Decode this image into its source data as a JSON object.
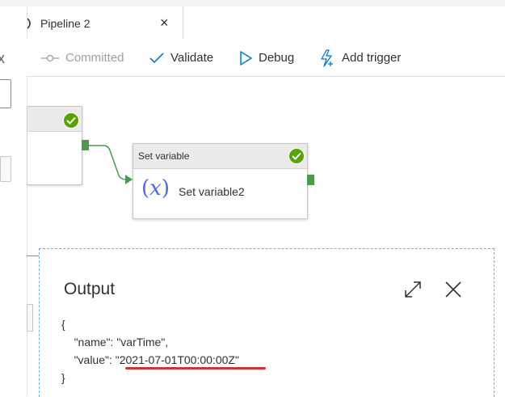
{
  "tab": {
    "title": "Pipeline 2",
    "close_label": "×",
    "icon": "pipeline-icon"
  },
  "left_panel": {
    "close_label": "x"
  },
  "toolbar": {
    "committed_label": "Committed",
    "validate_label": "Validate",
    "debug_label": "Debug",
    "add_trigger_label": "Add trigger"
  },
  "canvas": {
    "activity": {
      "type_label": "Set variable",
      "name": "Set variable2",
      "icon_label": "x"
    }
  },
  "output": {
    "title": "Output",
    "json_lines": {
      "open": "{",
      "name_key": "\"name\"",
      "name_sep": ": ",
      "name_val": "\"varTime\",",
      "value_key": "\"value\"",
      "value_sep": ": ",
      "value_val": "\"2021-07-01T00:00:00Z\"",
      "close": "}"
    }
  },
  "colors": {
    "success_green": "#57a300",
    "port_green": "#4a9b4a",
    "accent_blue": "#0078d4",
    "underline_red": "#d13438",
    "dashed_border": "#6cb4d6"
  }
}
